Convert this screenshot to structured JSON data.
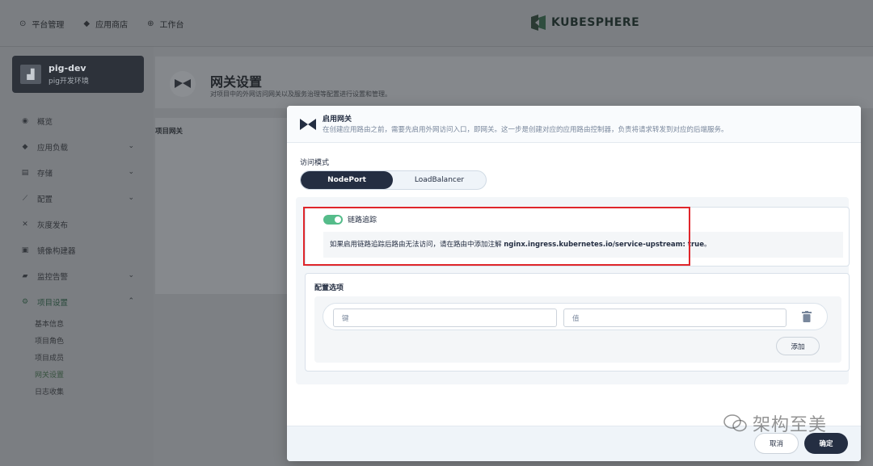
{
  "topnav": {
    "items": [
      {
        "label": "平台管理",
        "icon": "platform-icon"
      },
      {
        "label": "应用商店",
        "icon": "appstore-icon"
      },
      {
        "label": "工作台",
        "icon": "workbench-icon"
      }
    ],
    "brand": "KUBESPHERE"
  },
  "sidebar": {
    "project": {
      "name": "pig-dev",
      "subtitle": "pig开发环境"
    },
    "items": [
      {
        "label": "概览",
        "icon": "overview-icon"
      },
      {
        "label": "应用负载",
        "icon": "workload-icon",
        "expandable": true
      },
      {
        "label": "存储",
        "icon": "storage-icon",
        "expandable": true
      },
      {
        "label": "配置",
        "icon": "config-icon",
        "expandable": true
      },
      {
        "label": "灰度发布",
        "icon": "grayscale-icon"
      },
      {
        "label": "镜像构建器",
        "icon": "image-builder-icon"
      },
      {
        "label": "监控告警",
        "icon": "monitor-icon",
        "expandable": true
      },
      {
        "label": "项目设置",
        "icon": "settings-icon",
        "expanded": true
      }
    ],
    "settings_sub": [
      {
        "label": "基本信息"
      },
      {
        "label": "项目角色"
      },
      {
        "label": "项目成员"
      },
      {
        "label": "网关设置",
        "active": true
      },
      {
        "label": "日志收集"
      }
    ]
  },
  "page": {
    "title": "网关设置",
    "description": "对项目中的外网访问网关以及服务治理等配置进行设置和管理。",
    "section_label": "项目网关"
  },
  "modal": {
    "title": "启用网关",
    "description": "在创建应用路由之前，需要先启用外网访问入口，即网关。这一步是创建对应的应用路由控制器，负责将请求转发到对应的后端服务。",
    "access_mode_label": "访问模式",
    "access_modes": [
      "NodePort",
      "LoadBalancer"
    ],
    "selected_mode": "NodePort",
    "tracing": {
      "enabled": true,
      "label": "链路追踪",
      "note_prefix": "如果启用链路追踪后路由无法访问，请在路由中添加注解 ",
      "note_annotation": "nginx.ingress.kubernetes.io/service-upstream: true",
      "note_suffix": "。"
    },
    "options": {
      "title": "配置选项",
      "key_placeholder": "键",
      "value_placeholder": "值",
      "add_label": "添加"
    },
    "footer": {
      "cancel_label": "取消",
      "ok_label": "确定"
    }
  },
  "colors": {
    "accent_green": "#55bc8a",
    "dark": "#242e42",
    "highlight_red": "#e0262b"
  },
  "watermark": "架构至美"
}
